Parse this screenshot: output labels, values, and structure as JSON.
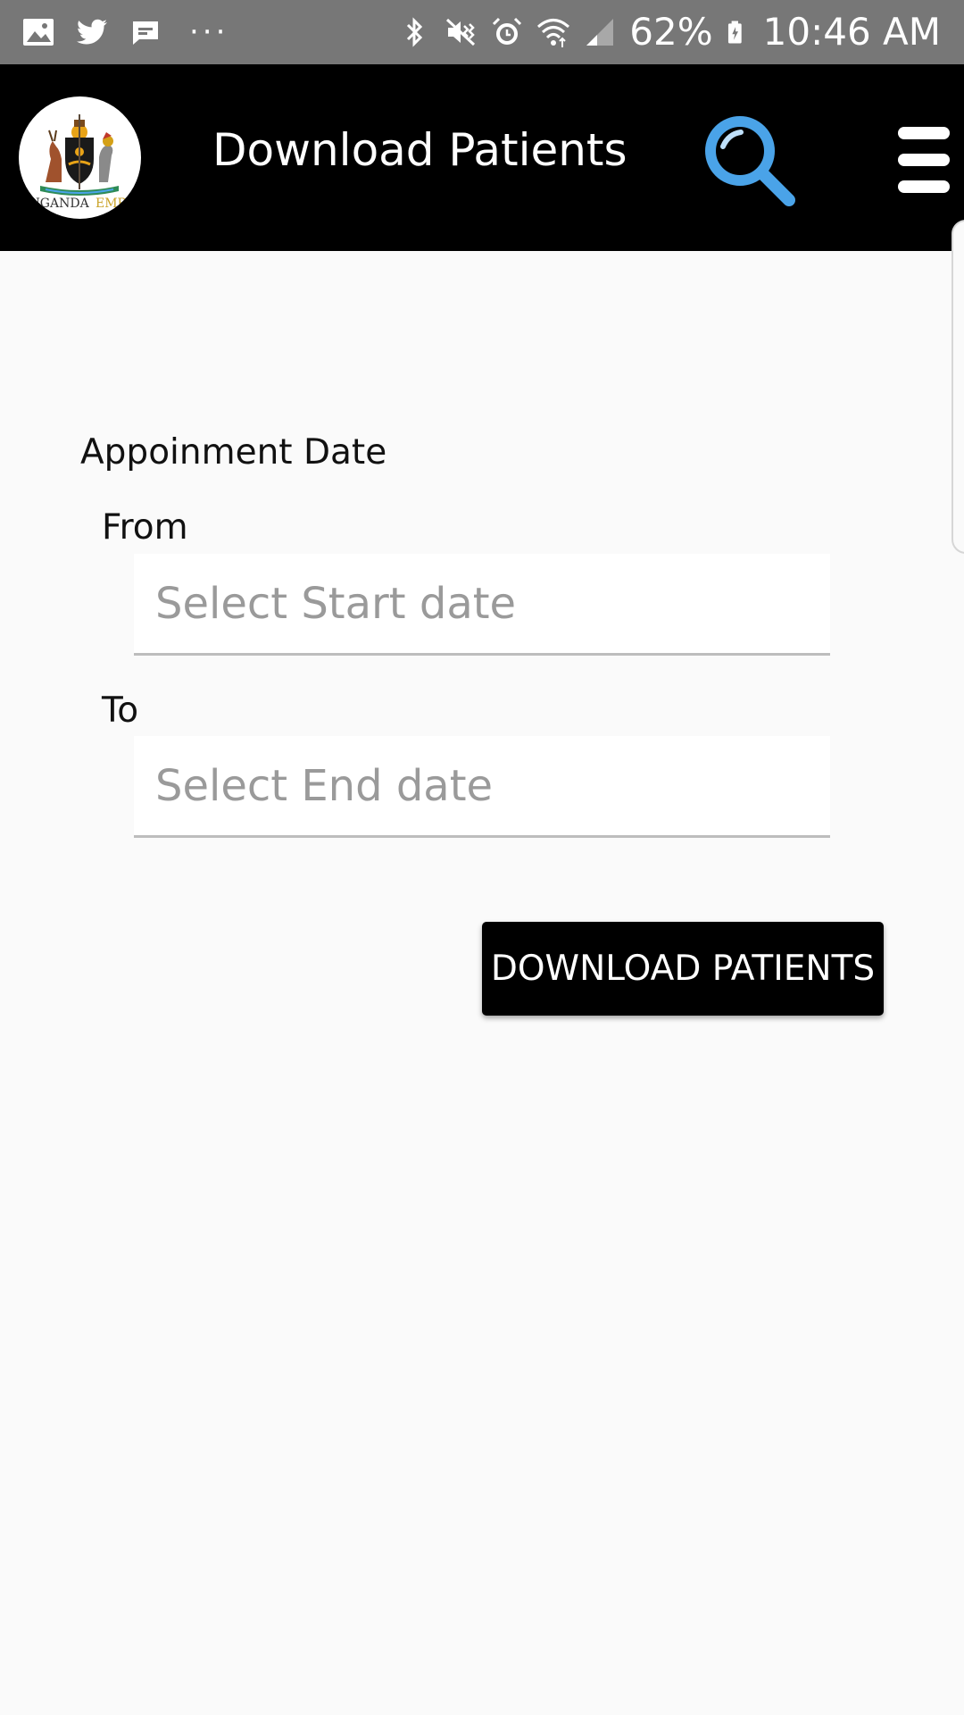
{
  "status_bar": {
    "left_icons": [
      "gallery-icon",
      "twitter-icon",
      "message-icon"
    ],
    "more": "···",
    "right_icons": [
      "bluetooth-icon",
      "vibrate-mute-icon",
      "alarm-icon",
      "wifi-icon",
      "signal-icon",
      "battery-charging-icon"
    ],
    "battery": "62%",
    "time": "10:46 AM"
  },
  "toolbar": {
    "logo_text_left": "UGANDA",
    "logo_text_right": "EMR",
    "title": "Download Patients",
    "search_icon": "search-icon",
    "menu_icon": "hamburger-menu-icon"
  },
  "form": {
    "section_label": "Appoinment Date",
    "from_label": "From",
    "start_date": {
      "value": "",
      "placeholder": "Select Start date"
    },
    "to_label": "To",
    "end_date": {
      "value": "",
      "placeholder": "Select End date"
    },
    "download_button": "DOWNLOAD PATIENTS"
  },
  "colors": {
    "status_bar": "#777777",
    "toolbar": "#000000",
    "background": "#fafafa",
    "search_icon": "#4aa3e8",
    "logo_emr": "#c9a227"
  }
}
